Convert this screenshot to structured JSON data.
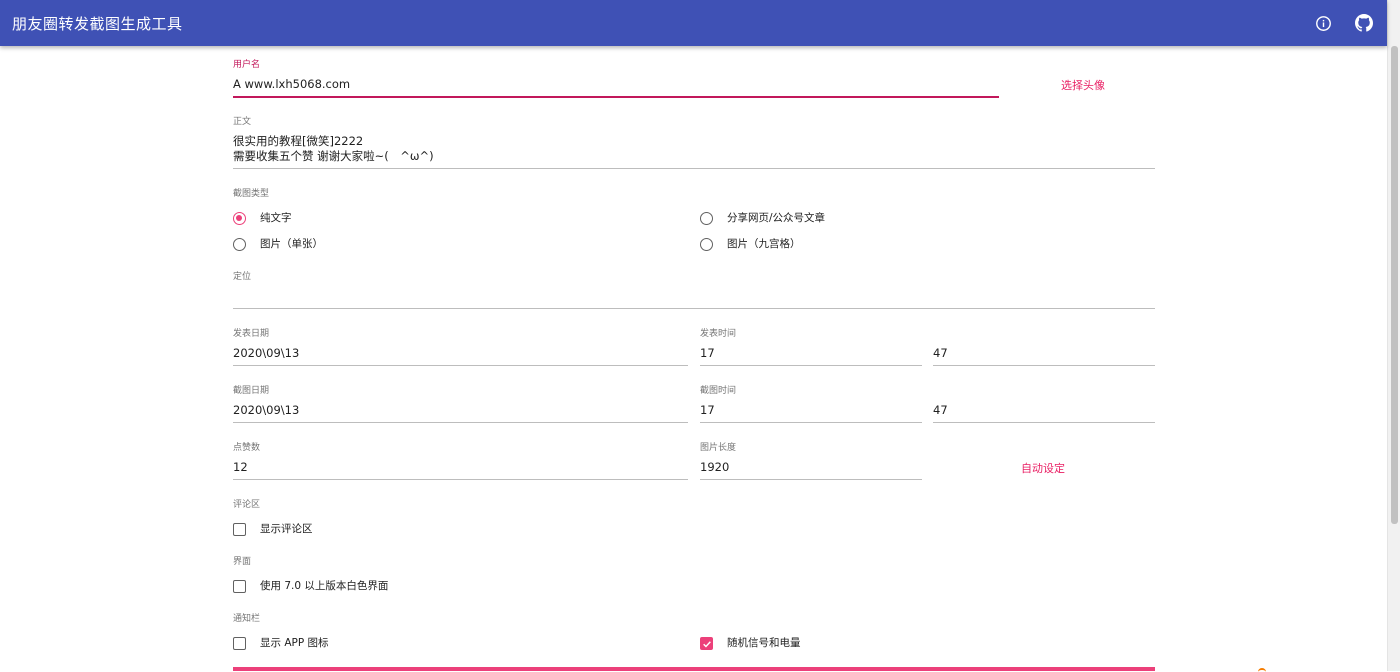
{
  "appbar": {
    "title": "朋友圈转发截图生成工具",
    "info_icon": "info-circle-icon",
    "github_icon": "github-icon"
  },
  "username": {
    "label": "用户名",
    "value": "A www.lxh5068.com",
    "select_avatar": "选择头像"
  },
  "body": {
    "label": "正文",
    "line1": "很实用的教程[微笑]2222",
    "line2": "需要收集五个赞 谢谢大家啦~(　^ω^)"
  },
  "screenshot_type": {
    "label": "截图类型",
    "options": [
      {
        "label": "纯文字",
        "selected": true
      },
      {
        "label": "分享网页/公众号文章",
        "selected": false
      },
      {
        "label": "图片（单张）",
        "selected": false
      },
      {
        "label": "图片（九宫格）",
        "selected": false
      }
    ]
  },
  "location": {
    "label": "定位",
    "value": ""
  },
  "post": {
    "date_label": "发表日期",
    "date_value": "2020\\09\\13",
    "time_label": "发表时间",
    "hour": "17",
    "minute": "47"
  },
  "capture": {
    "date_label": "截图日期",
    "date_value": "2020\\09\\13",
    "time_label": "截图时间",
    "hour": "17",
    "minute": "47"
  },
  "likes": {
    "label": "点赞数",
    "value": "12"
  },
  "image_length": {
    "label": "图片长度",
    "value": "1920",
    "auto": "自动设定"
  },
  "comments": {
    "label": "评论区",
    "option": "显示评论区",
    "checked": false
  },
  "interface": {
    "label": "界面",
    "option": "使用 7.0 以上版本白色界面",
    "checked": false
  },
  "statusbar": {
    "label": "通知栏",
    "show_app_icon": "显示 APP 图标",
    "show_app_icon_checked": false,
    "random_signal": "随机信号和电量",
    "random_signal_checked": true
  },
  "colors": {
    "primary": "#3f51b5",
    "accent": "#ec407a"
  }
}
